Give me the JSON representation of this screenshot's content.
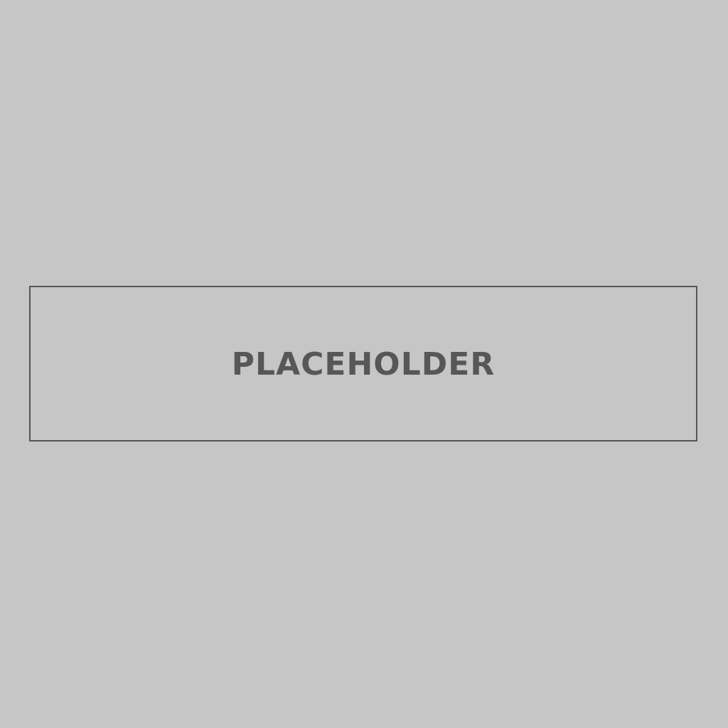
{
  "placeholder": {
    "label": "PLACEHOLDER"
  },
  "colors": {
    "background": "#c5c6c5",
    "border": "#555656",
    "text": "#575757"
  }
}
